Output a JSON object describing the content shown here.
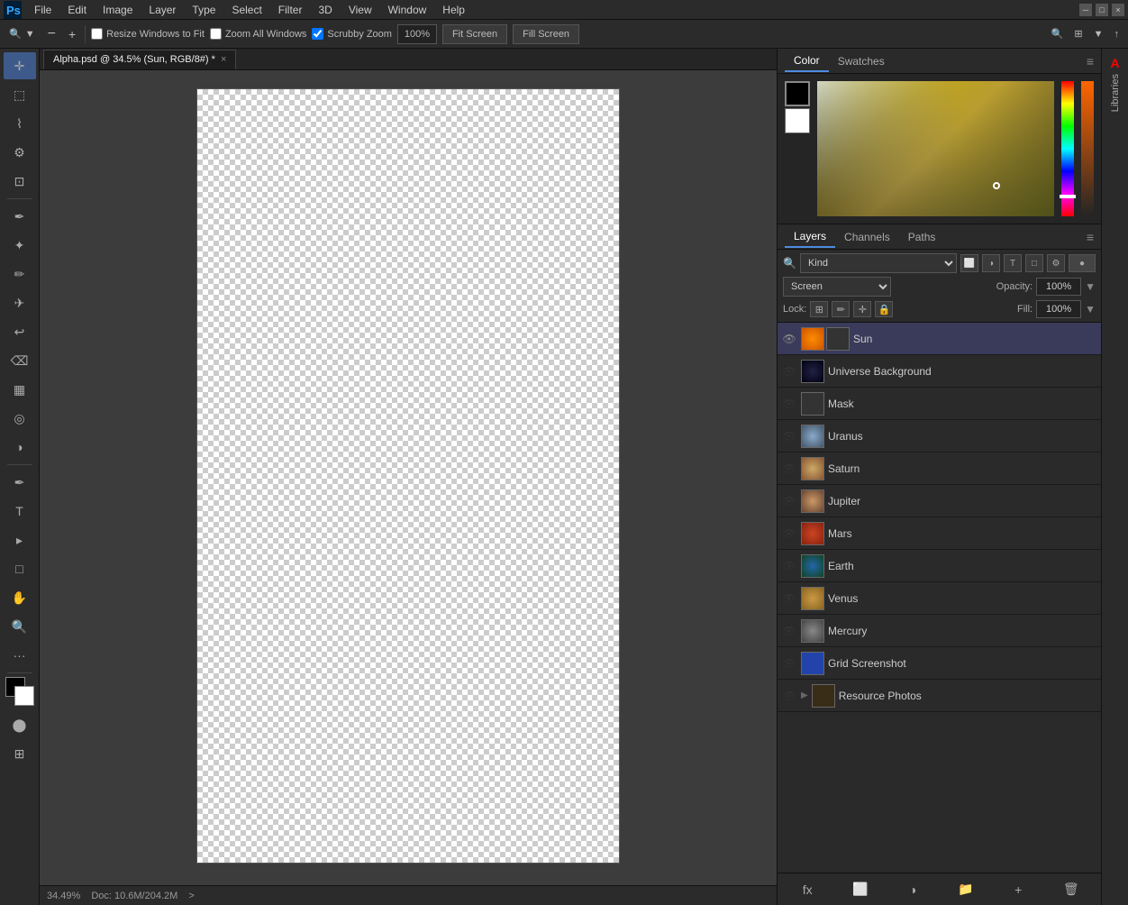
{
  "menubar": {
    "items": [
      "File",
      "Edit",
      "Image",
      "Layer",
      "Type",
      "Select",
      "Filter",
      "3D",
      "View",
      "Window",
      "Help"
    ]
  },
  "toolbar": {
    "zoom_label": "🔍",
    "zoom_out": "−",
    "zoom_in": "+",
    "resize_windows": "Resize Windows to Fit",
    "zoom_all_windows": "Zoom All Windows",
    "scrubby_zoom": "Scrubby Zoom",
    "zoom_percent": "100%",
    "fit_screen": "Fit Screen",
    "fill_screen": "Fill Screen"
  },
  "tab": {
    "title": "Alpha.psd @ 34.5% (Sun, RGB/8#) *",
    "close": "×"
  },
  "canvas_status": {
    "zoom": "34.49%",
    "doc_size": "Doc: 10.6M/204.2M",
    "arrow": ">"
  },
  "color_panel": {
    "tab1": "Color",
    "tab2": "Swatches"
  },
  "layers_panel": {
    "tab1": "Layers",
    "tab2": "Channels",
    "tab3": "Paths",
    "filter_label": "Kind",
    "blend_mode": "Screen",
    "opacity_label": "Opacity:",
    "opacity_val": "100%",
    "lock_label": "Lock:",
    "fill_label": "Fill:",
    "fill_val": "100%",
    "layers": [
      {
        "name": "Sun",
        "visible": true,
        "active": true,
        "type": "sun"
      },
      {
        "name": "Universe Background",
        "visible": false,
        "active": false,
        "type": "universe"
      },
      {
        "name": "Mask",
        "visible": false,
        "active": false,
        "type": "mask"
      },
      {
        "name": "Uranus",
        "visible": false,
        "active": false,
        "type": "planet"
      },
      {
        "name": "Saturn",
        "visible": false,
        "active": false,
        "type": "planet"
      },
      {
        "name": "Jupiter",
        "visible": false,
        "active": false,
        "type": "planet"
      },
      {
        "name": "Mars",
        "visible": false,
        "active": false,
        "type": "planet"
      },
      {
        "name": "Earth",
        "visible": false,
        "active": false,
        "type": "earth"
      },
      {
        "name": "Venus",
        "visible": false,
        "active": false,
        "type": "venus"
      },
      {
        "name": "Mercury",
        "visible": false,
        "active": false,
        "type": "mercury"
      },
      {
        "name": "Grid Screenshot",
        "visible": false,
        "active": false,
        "type": "grid"
      },
      {
        "name": "Resource Photos",
        "visible": false,
        "active": false,
        "type": "folder",
        "expandable": true
      }
    ]
  }
}
